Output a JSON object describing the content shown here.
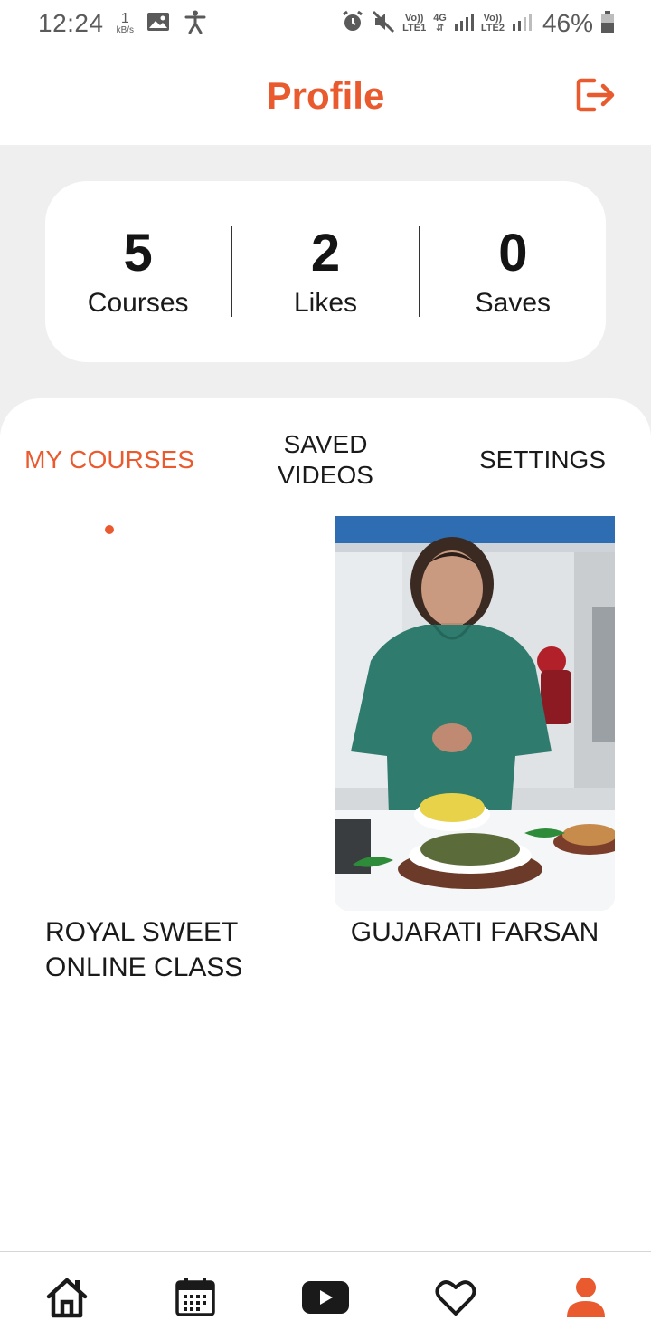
{
  "status_bar": {
    "time": "12:24",
    "speed_value": "1",
    "speed_unit": "kB/s",
    "sim1_top": "Vo))",
    "sim1_bottom": "LTE1",
    "network_type": "4G",
    "sim2_top": "Vo))",
    "sim2_bottom": "LTE2",
    "battery": "46%",
    "icons": [
      "image-icon",
      "accessibility-icon",
      "alarm-icon",
      "mute-icon",
      "signal-icon",
      "battery-icon"
    ]
  },
  "header": {
    "title": "Profile",
    "logout_icon": "logout-icon"
  },
  "stats": [
    {
      "value": "5",
      "label": "Courses"
    },
    {
      "value": "2",
      "label": "Likes"
    },
    {
      "value": "0",
      "label": "Saves"
    }
  ],
  "tabs": {
    "my_courses": "MY COURSES",
    "saved_line1": "SAVED",
    "saved_line2": "VIDEOS",
    "settings": "SETTINGS",
    "active": "my_courses"
  },
  "courses": [
    {
      "title_line1": "ROYAL SWEET",
      "title_line2": "ONLINE CLASS",
      "has_thumbnail": false
    },
    {
      "title_line1": "GUJARATI FARSAN",
      "title_line2": "",
      "has_thumbnail": true
    }
  ],
  "bottom_nav": {
    "items": [
      "home-icon",
      "calendar-icon",
      "video-icon",
      "heart-icon",
      "profile-icon"
    ],
    "active": "profile-icon"
  },
  "colors": {
    "accent": "#ea5a2f",
    "background_grey": "#efefef",
    "text": "#1a1a1a"
  }
}
